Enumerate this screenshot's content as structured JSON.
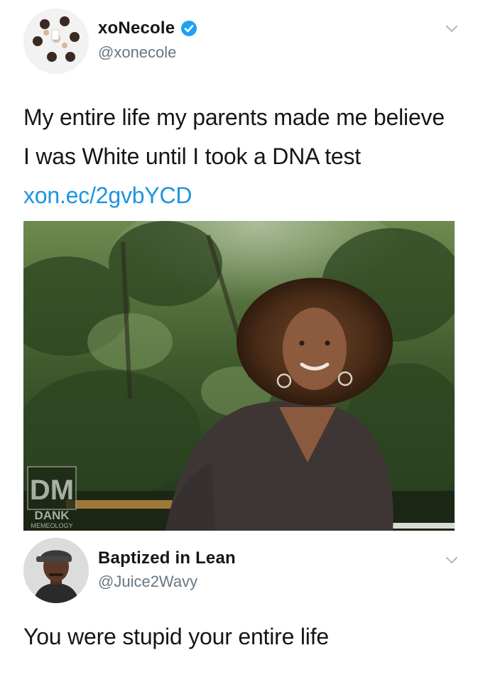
{
  "tweet": {
    "author": {
      "display_name": "xoNecole",
      "handle": "@xonecole",
      "verified": true,
      "avatar_icon": "group-photo-avatar"
    },
    "text": "My entire life my parents made me believe I was White until I took a DNA test ",
    "link": "xon.ec/2gvbYCD",
    "media": {
      "watermark_logo": "DM",
      "watermark_line1": "DANK",
      "watermark_line2": "MEMEOLOGY"
    },
    "menu_icon": "chevron-down-icon"
  },
  "reply": {
    "author": {
      "display_name": "Baptized in Lean",
      "handle": "@Juice2Wavy",
      "avatar_icon": "person-avatar"
    },
    "text": "You were stupid your entire life",
    "menu_icon": "chevron-down-icon"
  },
  "colors": {
    "link": "#1b95e0",
    "verified_badge": "#1da1f2",
    "handle_gray": "#657786",
    "text": "#14171a"
  }
}
